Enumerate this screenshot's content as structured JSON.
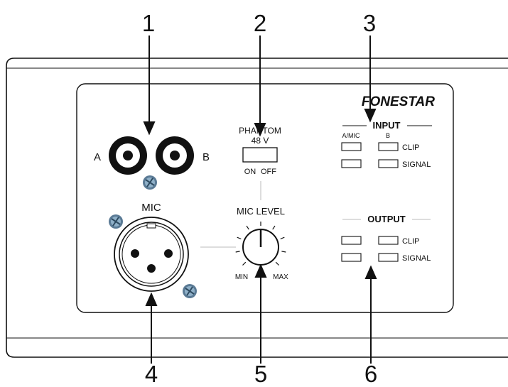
{
  "callouts": [
    "1",
    "2",
    "3",
    "4",
    "5",
    "6"
  ],
  "brand": "FONESTAR",
  "rca": {
    "left_label": "A",
    "right_label": "B"
  },
  "phantom": {
    "title": "PHANTOM",
    "voltage": "48 V",
    "on_label": "ON",
    "off_label": "OFF"
  },
  "mic": {
    "label": "MIC"
  },
  "mic_level": {
    "title": "MIC LEVEL",
    "min_label": "MIN",
    "max_label": "MAX"
  },
  "input": {
    "title": "INPUT",
    "col_a": "A/MIC",
    "col_b": "B",
    "clip": "CLIP",
    "signal": "SIGNAL"
  },
  "output": {
    "title": "OUTPUT",
    "clip": "CLIP",
    "signal": "SIGNAL"
  },
  "colors": {
    "line": "#111111",
    "screw": "#5a7a95",
    "divider": "#bbbbbb"
  }
}
